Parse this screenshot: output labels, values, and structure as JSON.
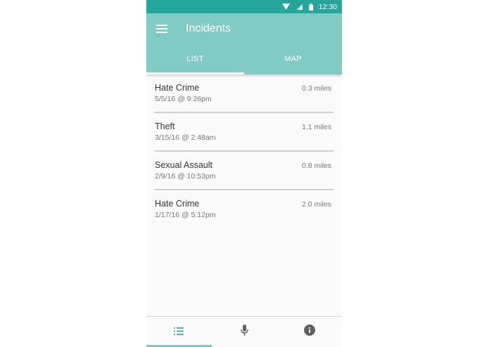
{
  "status_bar": {
    "time": "12:30",
    "icons": [
      "wifi-icon",
      "signal-icon",
      "battery-icon"
    ]
  },
  "app_bar": {
    "menu_icon": "menu-icon",
    "title": "Incidents"
  },
  "tabs": [
    {
      "label": "LIST",
      "active": true
    },
    {
      "label": "MAP",
      "active": false
    }
  ],
  "incidents": [
    {
      "name": "Hate Crime",
      "date": "5/5/16 @ 9:26pm",
      "distance": "0.3 miles"
    },
    {
      "name": "Theft",
      "date": "3/15/16 @ 2:48am",
      "distance": "1.1 miles"
    },
    {
      "name": "Sexual Assault",
      "date": "2/9/16 @ 10:53pm",
      "distance": "0.8 miles"
    },
    {
      "name": "Hate Crime",
      "date": "1/17/16 @ 5:12pm",
      "distance": "2.0 miles"
    }
  ],
  "bottom_nav": [
    {
      "icon": "list-icon",
      "active": true
    },
    {
      "icon": "microphone-icon",
      "active": false
    },
    {
      "icon": "info-icon",
      "active": false
    }
  ],
  "colors": {
    "status_bar": "#26a69a",
    "app_bar": "#80cbc4",
    "accent": "#80cbc4",
    "background": "#fafafa"
  }
}
